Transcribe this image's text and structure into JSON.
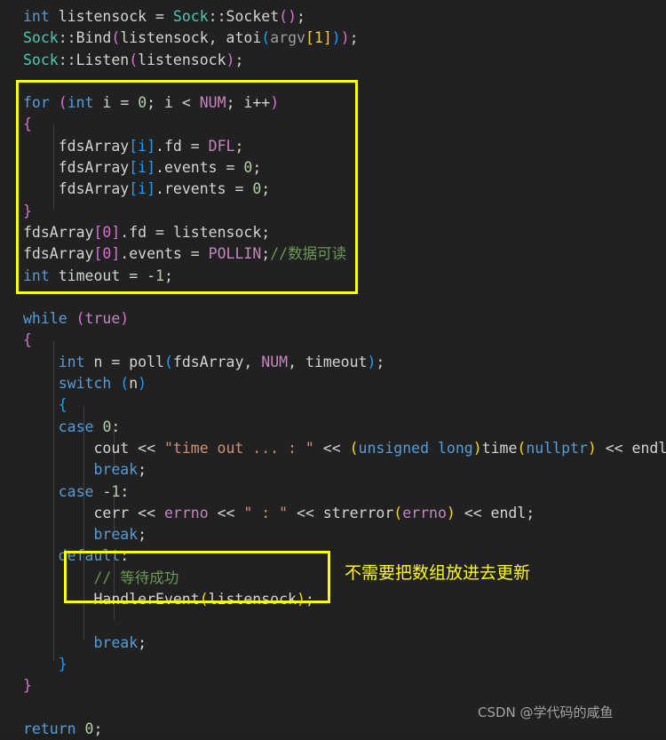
{
  "editor": {
    "background_color": "#212121",
    "language": "cpp",
    "theme": "dark-plus"
  },
  "code_lines": [
    "int listensock = Sock::Socket();",
    "Sock::Bind(listensock, atoi(argv[1]));",
    "Sock::Listen(listensock);",
    "",
    "for (int i = 0; i < NUM; i++)",
    "{",
    "    fdsArray[i].fd = DFL;",
    "    fdsArray[i].events = 0;",
    "    fdsArray[i].revents = 0;",
    "}",
    "fdsArray[0].fd = listensock;",
    "fdsArray[0].events = POLLIN;//数据可读",
    "int timeout = -1;",
    "",
    "while (true)",
    "{",
    "    int n = poll(fdsArray, NUM, timeout);",
    "    switch (n)",
    "    {",
    "    case 0:",
    "        cout << \"time out ... : \" << (unsigned long)time(nullptr) << endl;",
    "        break;",
    "    case -1:",
    "        cerr << errno << \" : \" << strerror(errno) << endl;",
    "        break;",
    "    default:",
    "        // 等待成功",
    "        HandlerEvent(listensock);",
    "",
    "        break;",
    "    }",
    "}",
    "",
    "return 0;"
  ],
  "tokens": {
    "keywords": [
      "int",
      "for",
      "while",
      "switch",
      "case",
      "default",
      "break",
      "return"
    ],
    "macros": [
      "NUM",
      "DFL",
      "POLLIN",
      "errno"
    ],
    "types": [
      "Sock"
    ],
    "literals": [
      "true",
      "nullptr",
      "0",
      "1",
      "-1"
    ],
    "strings": [
      "\"time out ... : \"",
      "\" : \""
    ],
    "comments": [
      "//数据可读",
      "// 等待成功"
    ],
    "functions": [
      "Socket",
      "Bind",
      "Listen",
      "atoi",
      "poll",
      "time",
      "strerror",
      "HandlerEvent"
    ],
    "streams": [
      "cout",
      "cerr",
      "endl"
    ]
  },
  "highlights": [
    {
      "name": "init-block",
      "label": "",
      "color": "#ffff00",
      "covers": "for-loop array initialization and listensock setup"
    },
    {
      "name": "handler-block",
      "label": "",
      "color": "#ffff00",
      "covers": "default case HandlerEvent call"
    }
  ],
  "annotation": {
    "text": "不需要把数组放进去更新",
    "color": "#ffff00"
  },
  "watermark": {
    "text": "CSDN @学代码的咸鱼",
    "color": "#b9b9b9"
  },
  "colors": {
    "background": "#212121",
    "keyword": "#569cd6",
    "type": "#4ec9b0",
    "macro": "#c586c0",
    "string": "#ce9178",
    "comment": "#6a9955",
    "number": "#b5cea8",
    "plain": "#d4d4d4",
    "bracket_l1": "#ffd700",
    "bracket_l2": "#da70d6",
    "bracket_l3": "#179fff",
    "highlight": "#ffff00"
  }
}
